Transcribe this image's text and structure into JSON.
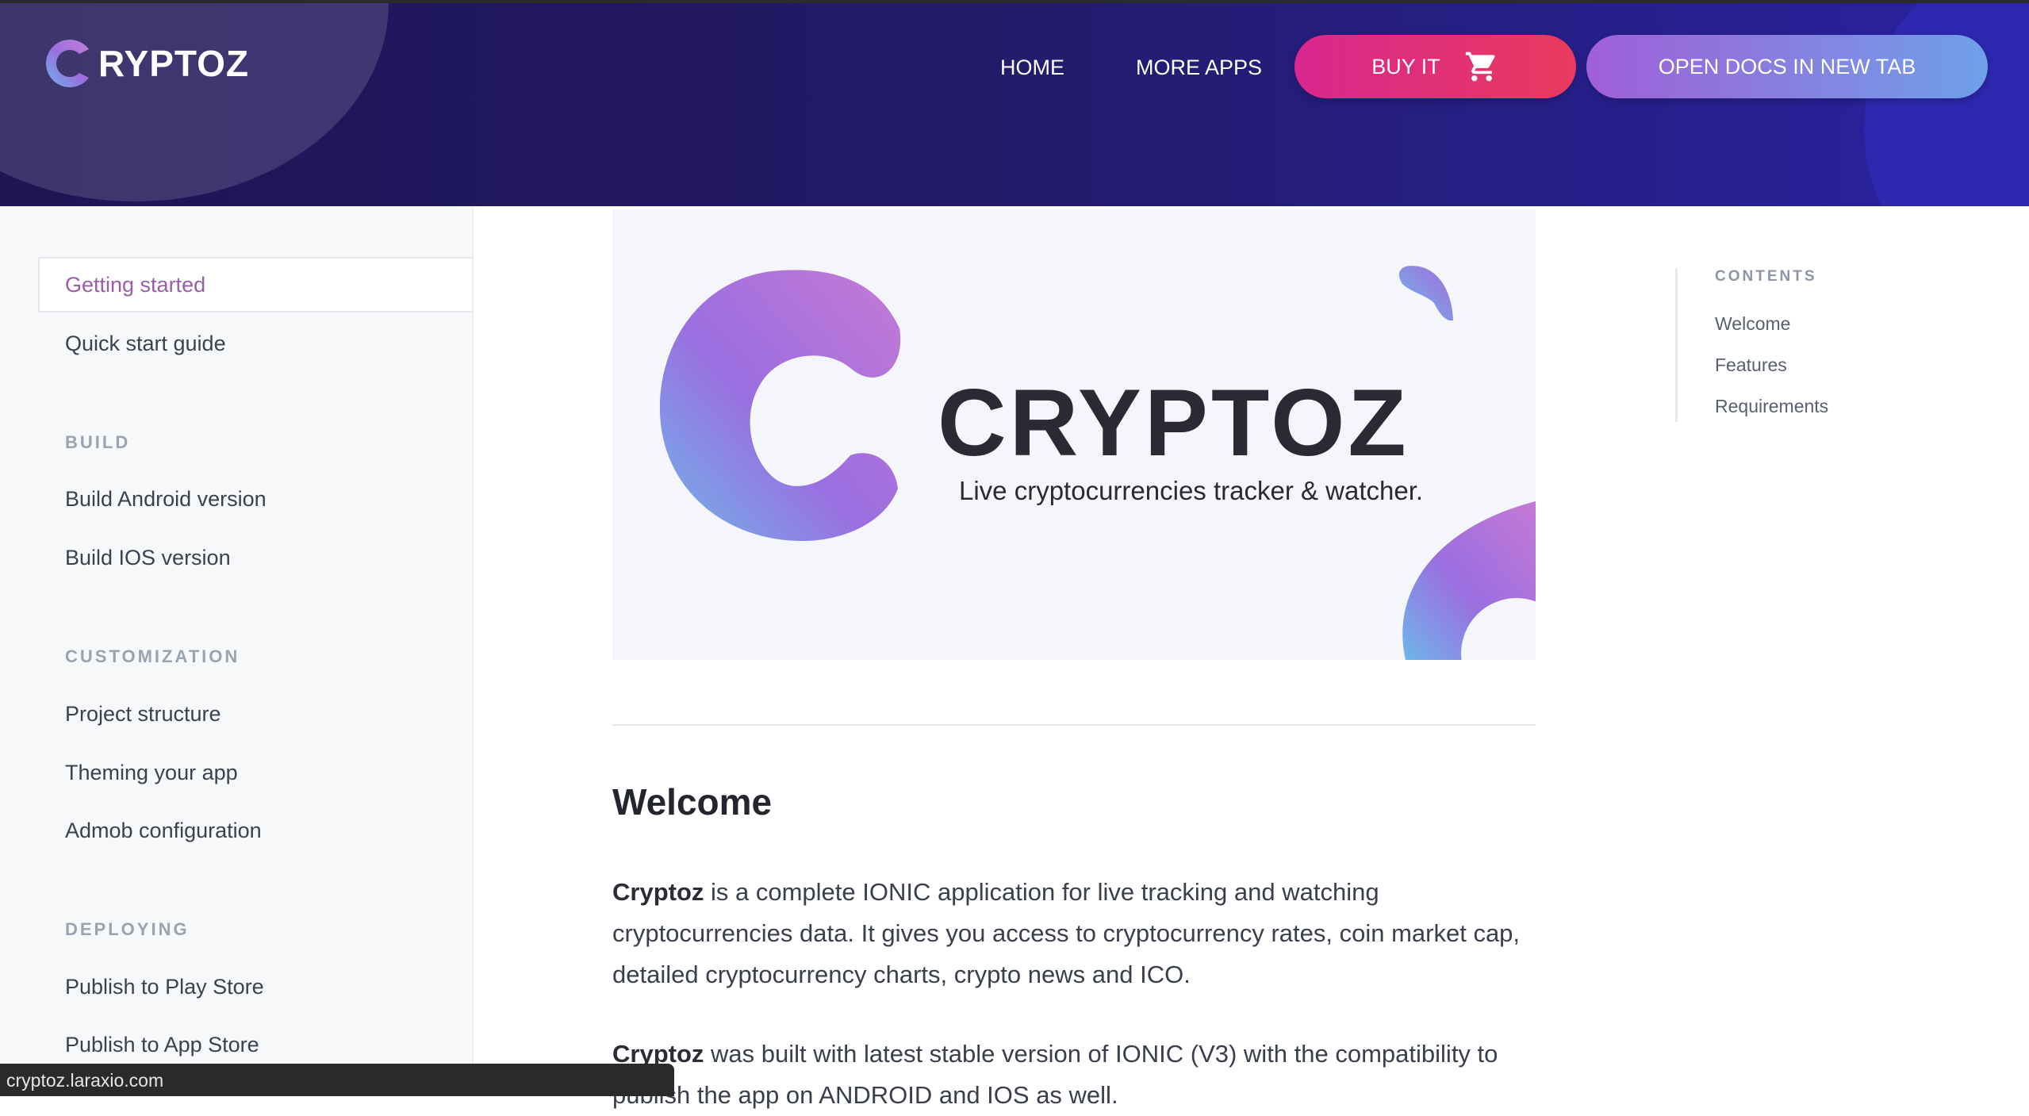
{
  "header": {
    "logo_text": "RYPTOZ",
    "nav": {
      "home": "HOME",
      "more_apps": "MORE APPS"
    },
    "buy_button": "BUY IT",
    "docs_button": "OPEN DOCS IN NEW TAB",
    "colors": {
      "bg": "#231a66",
      "buy": "#e02b78",
      "docs": "#8f7ce0"
    }
  },
  "sidebar": {
    "active_item": "Getting started",
    "items": [
      "Quick start guide"
    ],
    "sections": [
      {
        "title": "BUILD",
        "items": [
          "Build Android version",
          "Build IOS version"
        ]
      },
      {
        "title": "CUSTOMIZATION",
        "items": [
          "Project structure",
          "Theming your app",
          "Admob configuration"
        ]
      },
      {
        "title": "DEPLOYING",
        "items": [
          "Publish to Play Store",
          "Publish to App Store"
        ]
      }
    ]
  },
  "hero": {
    "brand": "CRYPTOZ",
    "tagline": "Live cryptocurrencies tracker & watcher."
  },
  "main": {
    "welcome_title": "Welcome",
    "para1_bold": "Cryptoz",
    "para1_text": " is a  complete IONIC application for live tracking and watching cryptocurrencies data. It gives you access to cryptocurrency rates, coin market cap, detailed cryptocurrency charts, crypto news and ICO.",
    "para2_bold": "Cryptoz",
    "para2_text": " was built with latest stable version of IONIC (V3) with the compatibility to publish the app on ANDROID and IOS as well."
  },
  "toc": {
    "title": "CONTENTS",
    "links": [
      "Welcome",
      "Features",
      "Requirements"
    ]
  },
  "status_bar": {
    "url": "cryptoz.laraxio.com"
  }
}
